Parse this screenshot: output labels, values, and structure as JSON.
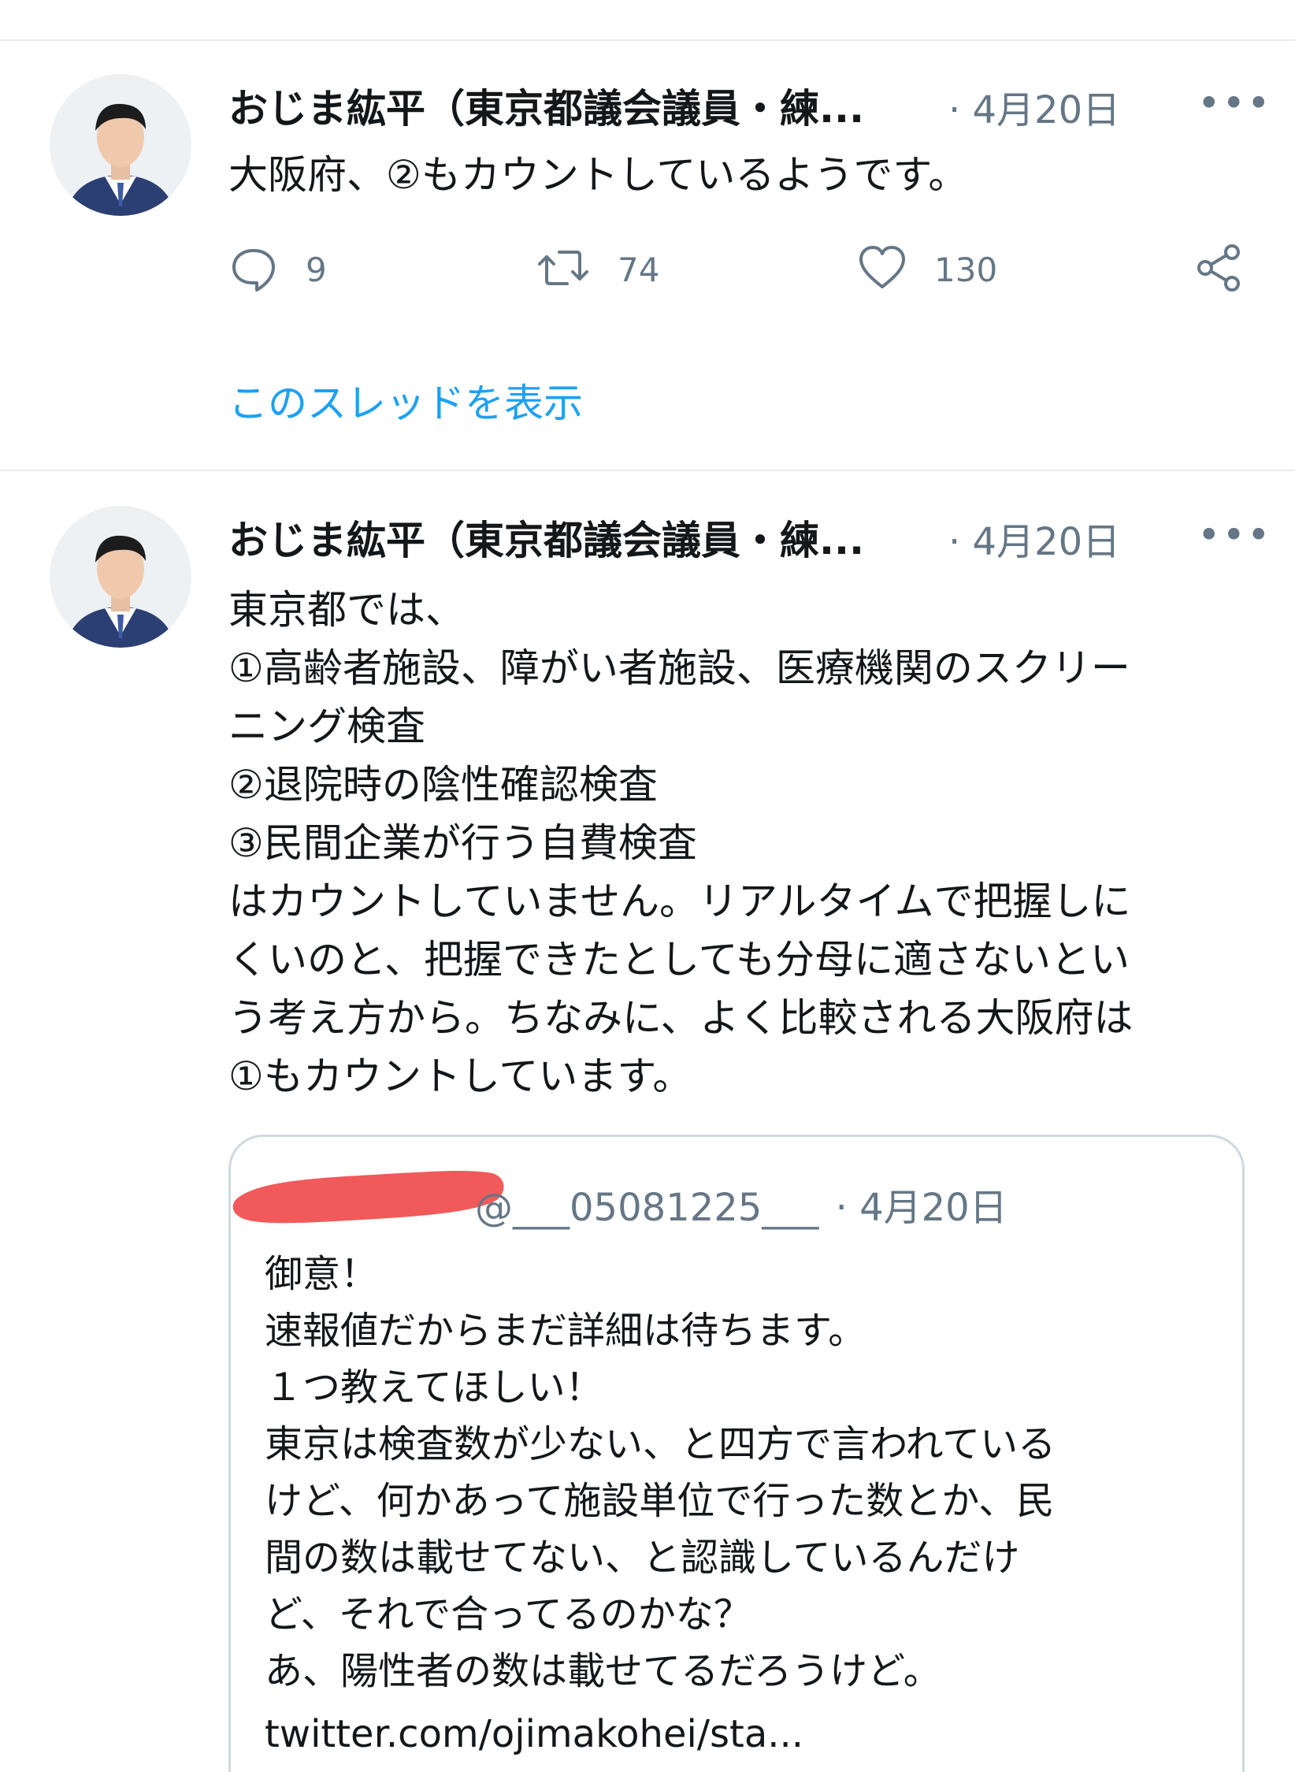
{
  "tweets": [
    {
      "author": "おじま紘平（東京都議会議員・練...",
      "date": "· 4月20日",
      "more": "•••",
      "text": "大阪府、②もカウントしているようです。",
      "replies": "9",
      "retweets": "74",
      "likes": "130",
      "thread_link": "このスレッドを表示"
    },
    {
      "author": "おじま紘平（東京都議会議員・練...",
      "date": "· 4月20日",
      "more": "•••",
      "text": "東京都では、\n①高齢者施設、障がい者施設、医療機関のスクリー\nニング検査\n②退院時の陰性確認検査\n③民間企業が行う自費検査\nはカウントしていません。リアルタイムで把握しに\nくいのと、把握できたとしても分母に適さないとい\nう考え方から。ちなみに、よく比較される大阪府は\n①もカウントしています。"
    }
  ],
  "quote": {
    "handle": "@___05081225___",
    "date": "· 4月20日",
    "text": "御意！\n速報値だからまだ詳細は待ちます。\n１つ教えてほしい！\n東京は検査数が少ない、と四方で言われている\nけど、何かあって施設単位で行った数とか、民\n間の数は載せてない、と認識しているんだけ\nど、それで合ってるのかな？\nあ、陽性者の数は載せてるだろうけど。",
    "link": "twitter.com/ojimakohei/sta..."
  },
  "icons": {
    "reply": "reply-bubble-icon",
    "retweet": "retweet-icon",
    "like": "heart-icon",
    "share": "share-icon"
  },
  "colors": {
    "accent": "#1da1f2",
    "muted": "#657786",
    "divider": "#e6ecf0",
    "redaction": "#f15a5a"
  }
}
